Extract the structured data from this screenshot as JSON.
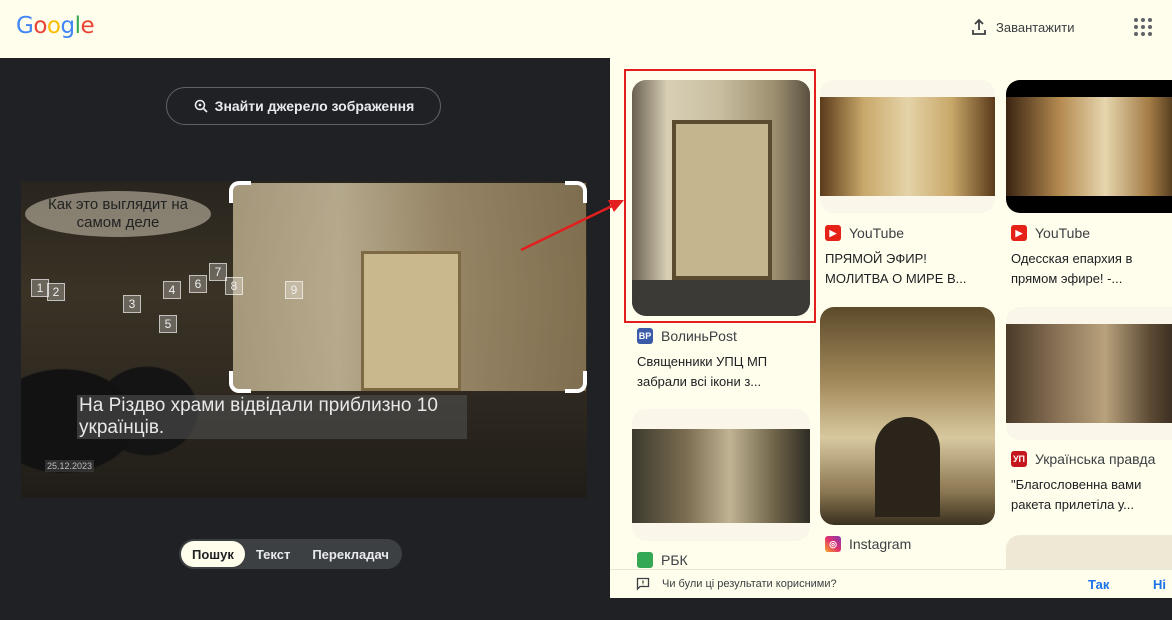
{
  "header": {
    "logo_letters": [
      "G",
      "o",
      "o",
      "g",
      "l",
      "e"
    ],
    "upload_label": "Завантажити"
  },
  "left": {
    "find_source_label": "Знайти джерело зображення",
    "photo": {
      "bubble_text": "Как это выглядит на самом деле",
      "caption": "На Різдво храми відвідали приблизно 10 українців.",
      "date": "25.12.2023",
      "markers": [
        "1",
        "2",
        "3",
        "4",
        "5",
        "6",
        "7",
        "8",
        "9"
      ]
    },
    "modes": [
      "Пошук",
      "Текст",
      "Перекладач"
    ],
    "active_mode": "Пошук"
  },
  "results": [
    {
      "source": "ВолиньPost",
      "source_icon": "volynpost-icon",
      "title": "Священники УПЦ МП забрали всі ікони з..."
    },
    {
      "source": "YouTube",
      "source_icon": "youtube-icon",
      "title": "ПРЯМОЙ ЭФИР! МОЛИТВА О МИРЕ В..."
    },
    {
      "source": "YouTube",
      "source_icon": "youtube-icon",
      "title": "Одесская епархия в прямом эфире! -..."
    },
    {
      "source": "РБК",
      "source_icon": "rbk-icon",
      "title": ""
    },
    {
      "source": "Instagram",
      "source_icon": "instagram-icon",
      "title": ""
    },
    {
      "source": "Українська правда",
      "source_icon": "pravda-icon",
      "source_badge": "УП",
      "title": "\"Благословенна вами ракета прилетіла у..."
    }
  ],
  "feedback": {
    "question": "Чи були ці результати корисними?",
    "yes": "Так",
    "no": "Ні"
  },
  "colors": {
    "accent_blue": "#1a73e8",
    "highlight_red": "#e41e1e",
    "panel_cream": "#fffdeb",
    "dark_bg": "#202124"
  }
}
